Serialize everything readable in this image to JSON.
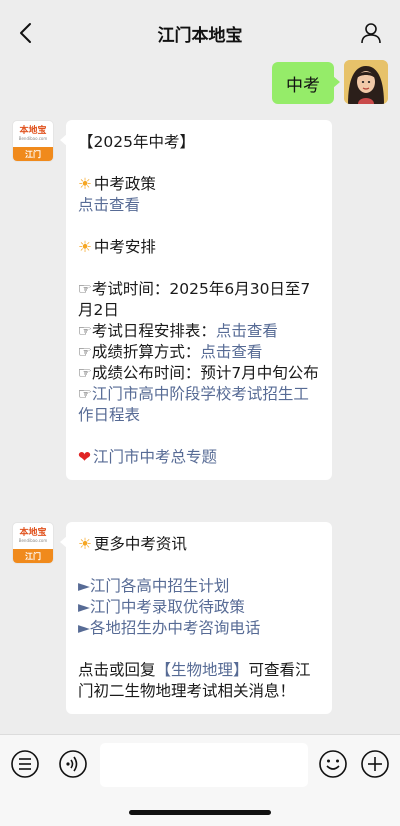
{
  "header": {
    "title": "江门本地宝"
  },
  "sent_message": {
    "text": "中考"
  },
  "brand_avatar": {
    "name": "本地宝",
    "url": "Bendibao.com",
    "city": "江门"
  },
  "message1": {
    "title": "【2025年中考】",
    "policy_title": "中考政策",
    "policy_link": "点击查看",
    "arrange_title": "中考安排",
    "exam_time": "☞考试时间：2025年6月30日至7月2日",
    "schedule_label": "☞考试日程安排表：",
    "schedule_link": "点击查看",
    "score_label": "☞成绩折算方式：",
    "score_link": "点击查看",
    "publish_time": "☞成绩公布时间：预计7月中旬公布",
    "work_schedule_prefix": "☞",
    "work_schedule_link": "江门市高中阶段学校考试招生工作日程表",
    "topic_link": "江门市中考总专题"
  },
  "message2": {
    "title": "更多中考资讯",
    "item1": "►江门各高中招生计划",
    "item2": "►江门中考录取优待政策",
    "item3": "►各地招生办中考咨询电话",
    "reply_prefix": "点击或回复",
    "reply_keyword": "【生物地理】",
    "reply_suffix": "可查看江门初二生物地理考试相关消息！"
  },
  "input": {
    "placeholder": ""
  },
  "colors": {
    "link": "#576b95",
    "green_bubble": "#95ec69",
    "background": "#ededed"
  }
}
